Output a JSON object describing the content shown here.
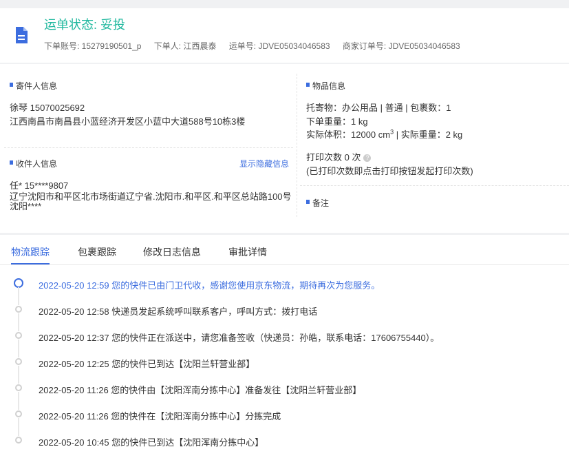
{
  "header": {
    "status_label": "运单状态: 妥投",
    "order_account": "下单账号: 15279190501_p",
    "order_person": "下单人: 江西晨泰",
    "waybill_no": "运单号: JDVE05034046583",
    "merchant_order_no": "商家订单号: JDVE05034046583",
    "icon": "document-icon",
    "accent_color": "#1fb89e"
  },
  "sender": {
    "section_title": "寄件人信息",
    "name_phone": "徐琴   15070025692",
    "address": "江西南昌市南昌县小蓝经济开发区小蓝中大道588号10栋3楼"
  },
  "receiver": {
    "section_title": "收件人信息",
    "show_hidden_link": "显示隐藏信息",
    "name_phone": "任*   15****9807",
    "address": "辽宁沈阳市和平区北市场街道辽宁省.沈阳市.和平区.和平区总站路100号沈阳****"
  },
  "goods": {
    "section_title": "物品信息",
    "line1": "托寄物：办公用品 | 普通 | 包裹数：1",
    "line2": "下单重量：1 kg",
    "line3_prefix": "实际体积：12000 cm",
    "line3_sup": "3",
    "line3_suffix": " | 实际重量：2 kg",
    "print_count": "打印次数   0 次",
    "print_note": "(已打印次数即点击打印按钮发起打印次数)"
  },
  "remarks": {
    "section_title": "备注"
  },
  "tabs": [
    {
      "label": "物流跟踪",
      "active": true
    },
    {
      "label": "包裹跟踪",
      "active": false
    },
    {
      "label": "修改日志信息",
      "active": false
    },
    {
      "label": "审批详情",
      "active": false
    }
  ],
  "tracking": [
    {
      "text": "2022-05-20 12:59 您的快件已由门卫代收，感谢您使用京东物流，期待再次为您服务。",
      "active": true
    },
    {
      "text": "2022-05-20 12:58 快递员发起系统呼叫联系客户，呼叫方式：拨打电话",
      "active": false
    },
    {
      "text": "2022-05-20 12:37 您的快件正在派送中，请您准备签收（快递员：孙皓，联系电话：17606755440）。",
      "active": false
    },
    {
      "text": "2022-05-20 12:25 您的快件已到达【沈阳兰轩营业部】",
      "active": false
    },
    {
      "text": "2022-05-20 11:26 您的快件由【沈阳浑南分拣中心】准备发往【沈阳兰轩营业部】",
      "active": false
    },
    {
      "text": "2022-05-20 11:26 您的快件在【沈阳浑南分拣中心】分拣完成",
      "active": false
    },
    {
      "text": "2022-05-20 10:45 您的快件已到达【沈阳浑南分拣中心】",
      "active": false
    }
  ],
  "colors": {
    "link": "#3c6ddf",
    "muted": "#d0d0d0"
  }
}
